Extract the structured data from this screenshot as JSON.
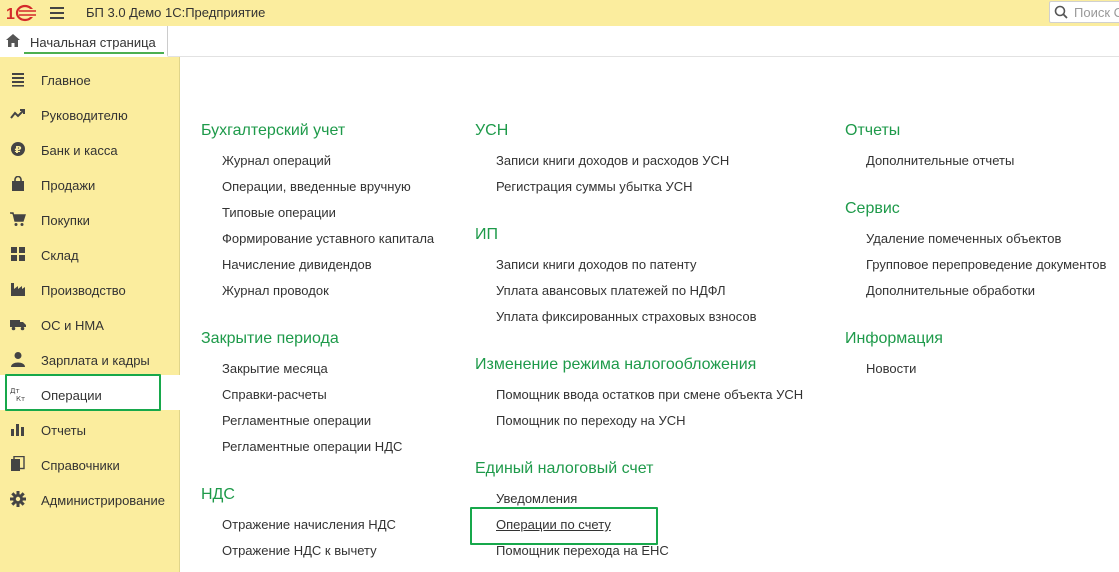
{
  "app": {
    "title": "БП 3.0 Демо 1С:Предприятие",
    "search_placeholder": "Поиск С"
  },
  "home_tab": {
    "label": "Начальная страница"
  },
  "sidebar": {
    "items": [
      {
        "label": "Главное",
        "icon": "list-icon"
      },
      {
        "label": "Руководителю",
        "icon": "trend-icon"
      },
      {
        "label": "Банк и касса",
        "icon": "ruble-coin-icon"
      },
      {
        "label": "Продажи",
        "icon": "shopping-bag-icon"
      },
      {
        "label": "Покупки",
        "icon": "cart-icon"
      },
      {
        "label": "Склад",
        "icon": "grid-icon"
      },
      {
        "label": "Производство",
        "icon": "factory-icon"
      },
      {
        "label": "ОС и НМА",
        "icon": "truck-icon"
      },
      {
        "label": "Зарплата и кадры",
        "icon": "person-icon"
      },
      {
        "label": "Операции",
        "icon": "dt-kt-icon",
        "active": true
      },
      {
        "label": "Отчеты",
        "icon": "bar-chart-icon"
      },
      {
        "label": "Справочники",
        "icon": "books-icon"
      },
      {
        "label": "Администрирование",
        "icon": "gear-icon"
      }
    ]
  },
  "content": {
    "col1": {
      "sections": [
        {
          "title": "Бухгалтерский учет",
          "links": [
            "Журнал операций",
            "Операции, введенные вручную",
            "Типовые операции",
            "Формирование уставного капитала",
            "Начисление дивидендов",
            "Журнал проводок"
          ]
        },
        {
          "title": "Закрытие периода",
          "links": [
            "Закрытие месяца",
            "Справки-расчеты",
            "Регламентные операции",
            "Регламентные операции НДС"
          ]
        },
        {
          "title": "НДС",
          "links": [
            "Отражение начисления НДС",
            "Отражение НДС к вычету"
          ]
        }
      ]
    },
    "col2": {
      "sections": [
        {
          "title": "УСН",
          "links": [
            "Записи книги доходов и расходов УСН",
            "Регистрация суммы убытка УСН"
          ]
        },
        {
          "title": "ИП",
          "links": [
            "Записи книги доходов по патенту",
            "Уплата авансовых платежей по НДФЛ",
            "Уплата фиксированных страховых взносов"
          ]
        },
        {
          "title": "Изменение режима налогообложения",
          "links": [
            "Помощник ввода остатков при смене объекта УСН",
            "Помощник по переходу на УСН"
          ]
        },
        {
          "title": "Единый налоговый счет",
          "links": [
            "Уведомления",
            "Операции по счету",
            "Помощник перехода на ЕНС"
          ]
        }
      ]
    },
    "col3": {
      "sections": [
        {
          "title": "Отчеты",
          "links": [
            "Дополнительные отчеты"
          ]
        },
        {
          "title": "Сервис",
          "links": [
            "Удаление помеченных объектов",
            "Групповое перепроведение документов",
            "Дополнительные обработки"
          ]
        },
        {
          "title": "Информация",
          "links": [
            "Новости"
          ]
        }
      ]
    }
  },
  "colors": {
    "panel_yellow": "#fbed9e",
    "section_green": "#1e9a4a",
    "highlight_green": "#17a84b",
    "logo_red": "#d42a2a"
  }
}
